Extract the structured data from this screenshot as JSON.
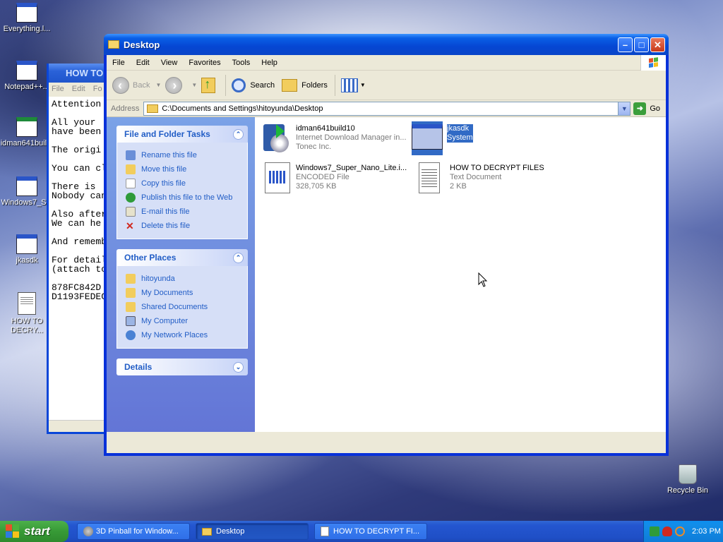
{
  "desktop": {
    "icons": [
      {
        "label": "Everything.l..."
      },
      {
        "label": "Notepad++..."
      },
      {
        "label": "idman641buil..."
      },
      {
        "label": "Windows7_S..."
      },
      {
        "label": "jkasdk"
      },
      {
        "label": "HOW TO DECRY..."
      },
      {
        "label": "Recycle Bin"
      }
    ]
  },
  "notepad": {
    "title": "HOW TO",
    "menu": "File Edit Fo",
    "lines": [
      "Attention",
      "",
      "All your",
      "have been",
      "",
      "The origi",
      "",
      "You can cl",
      "",
      "There is",
      "Nobody can",
      "",
      "Also after",
      "We can he",
      "",
      "And rememb",
      "",
      "For detail",
      "(attach to",
      "",
      "878FC842D",
      "D1193FEDEC"
    ]
  },
  "explorer": {
    "title": "Desktop",
    "menu": [
      "File",
      "Edit",
      "View",
      "Favorites",
      "Tools",
      "Help"
    ],
    "toolbar": {
      "back": "Back",
      "search": "Search",
      "folders": "Folders"
    },
    "address": {
      "label": "Address",
      "value": "C:\\Documents and Settings\\hitoyunda\\Desktop",
      "go": "Go"
    },
    "file_tasks": {
      "title": "File and Folder Tasks",
      "items": [
        "Rename this file",
        "Move this file",
        "Copy this file",
        "Publish this file to the Web",
        "E-mail this file",
        "Delete this file"
      ]
    },
    "other_places": {
      "title": "Other Places",
      "items": [
        "hitoyunda",
        "My Documents",
        "Shared Documents",
        "My Computer",
        "My Network Places"
      ]
    },
    "details": {
      "title": "Details"
    },
    "files": [
      {
        "name": "idman641build10",
        "line2": "Internet Download Manager in...",
        "line3": "Tonec Inc."
      },
      {
        "name": "jkasdk",
        "line2": "System",
        "line3": ""
      },
      {
        "name": "Windows7_Super_Nano_Lite.i...",
        "line2": "ENCODED File",
        "line3": "328,705 KB"
      },
      {
        "name": "HOW TO DECRYPT FILES",
        "line2": "Text Document",
        "line3": "2 KB"
      }
    ]
  },
  "taskbar": {
    "start": "start",
    "buttons": [
      "3D Pinball for Window...",
      "Desktop",
      "HOW TO DECRYPT FI..."
    ],
    "clock": "2:03 PM"
  }
}
